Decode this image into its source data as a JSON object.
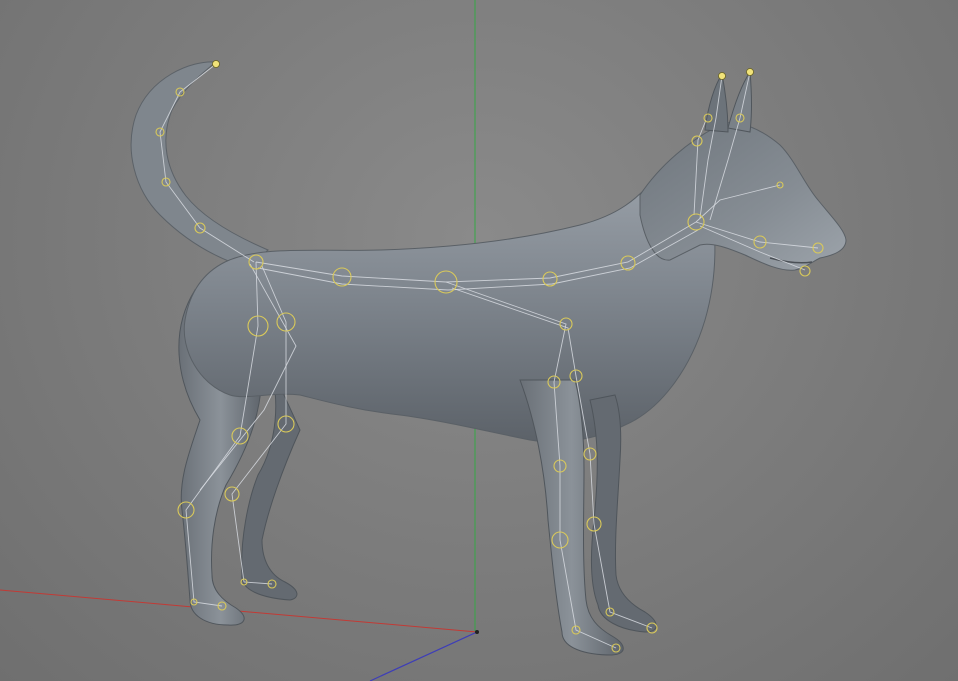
{
  "viewport": {
    "view_type": "3d-perspective",
    "background_color": "#7b7b7b",
    "model": {
      "subject": "rigged dog mesh",
      "mesh_color": "#8c939b",
      "skeleton_color": "#d8dce2",
      "joint_color": "#d9c95a"
    },
    "axes": {
      "x_color": "#c23a35",
      "y_color": "#35a845",
      "z_color": "#3d3db8"
    }
  }
}
